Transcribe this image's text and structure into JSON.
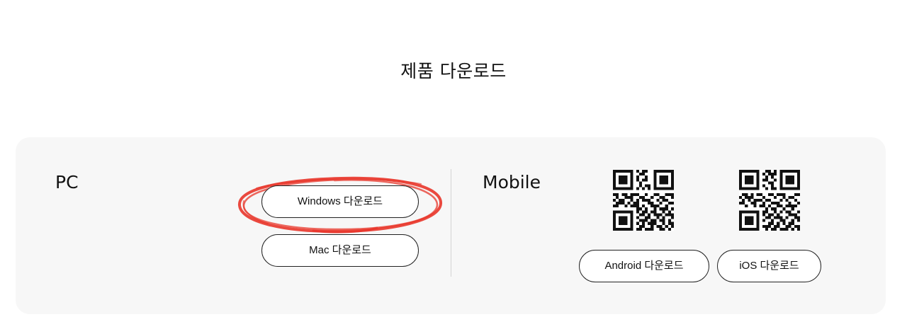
{
  "page_title": "제품 다운로드",
  "pc": {
    "label": "PC",
    "windows_button": "Windows 다운로드",
    "mac_button": "Mac 다운로드"
  },
  "mobile": {
    "label": "Mobile",
    "android_button": "Android 다운로드",
    "ios_button": "iOS 다운로드"
  },
  "icons": {
    "android_qr": "qr-code-icon",
    "ios_qr": "qr-code-icon"
  },
  "colors": {
    "panel_background": "#f7f7f7",
    "highlight_annotation": "#e8352a",
    "button_border": "#222222"
  }
}
